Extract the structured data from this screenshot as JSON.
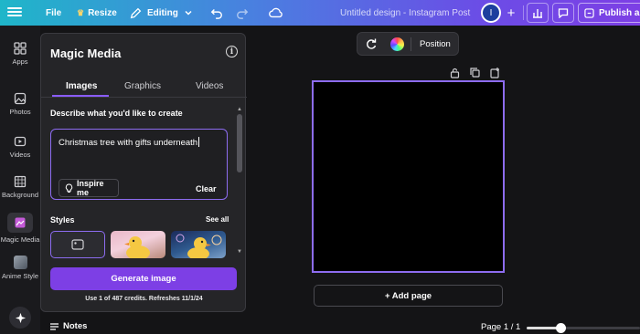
{
  "topbar": {
    "file_label": "File",
    "resize_label": "Resize",
    "editing_label": "Editing",
    "title": "Untitled design - Instagram Post",
    "avatar_initial": "I",
    "publish_label": "Publish as"
  },
  "rail": {
    "items": [
      {
        "label": "Apps",
        "icon": "apps-icon"
      },
      {
        "label": "Photos",
        "icon": "photos-icon"
      },
      {
        "label": "Videos",
        "icon": "videos-icon"
      },
      {
        "label": "Background",
        "icon": "background-icon"
      },
      {
        "label": "Magic Media",
        "icon": "magic-media-icon"
      },
      {
        "label": "Anime Style",
        "icon": "anime-style-icon"
      }
    ]
  },
  "panel": {
    "title": "Magic Media",
    "tabs": [
      {
        "label": "Images",
        "active": true
      },
      {
        "label": "Graphics",
        "active": false
      },
      {
        "label": "Videos",
        "active": false
      }
    ],
    "describe_label": "Describe what you'd like to create",
    "prompt_value": "Christmas tree with gifts underneath",
    "inspire_label": "Inspire me",
    "clear_label": "Clear",
    "styles_label": "Styles",
    "see_all_label": "See all",
    "generate_label": "Generate image",
    "credits_text": "Use 1 of 487 credits. Refreshes 11/1/24"
  },
  "canvas_toolbar": {
    "position_label": "Position"
  },
  "canvas": {
    "add_page_label": "+ Add page"
  },
  "bottombar": {
    "notes_label": "Notes",
    "page_label": "Page 1 / 1",
    "zoom_fraction": 0.3
  },
  "colors": {
    "accent": "#7d3fe5",
    "selection": "#8d6cf0",
    "background": "#141416",
    "panel": "#252528"
  }
}
